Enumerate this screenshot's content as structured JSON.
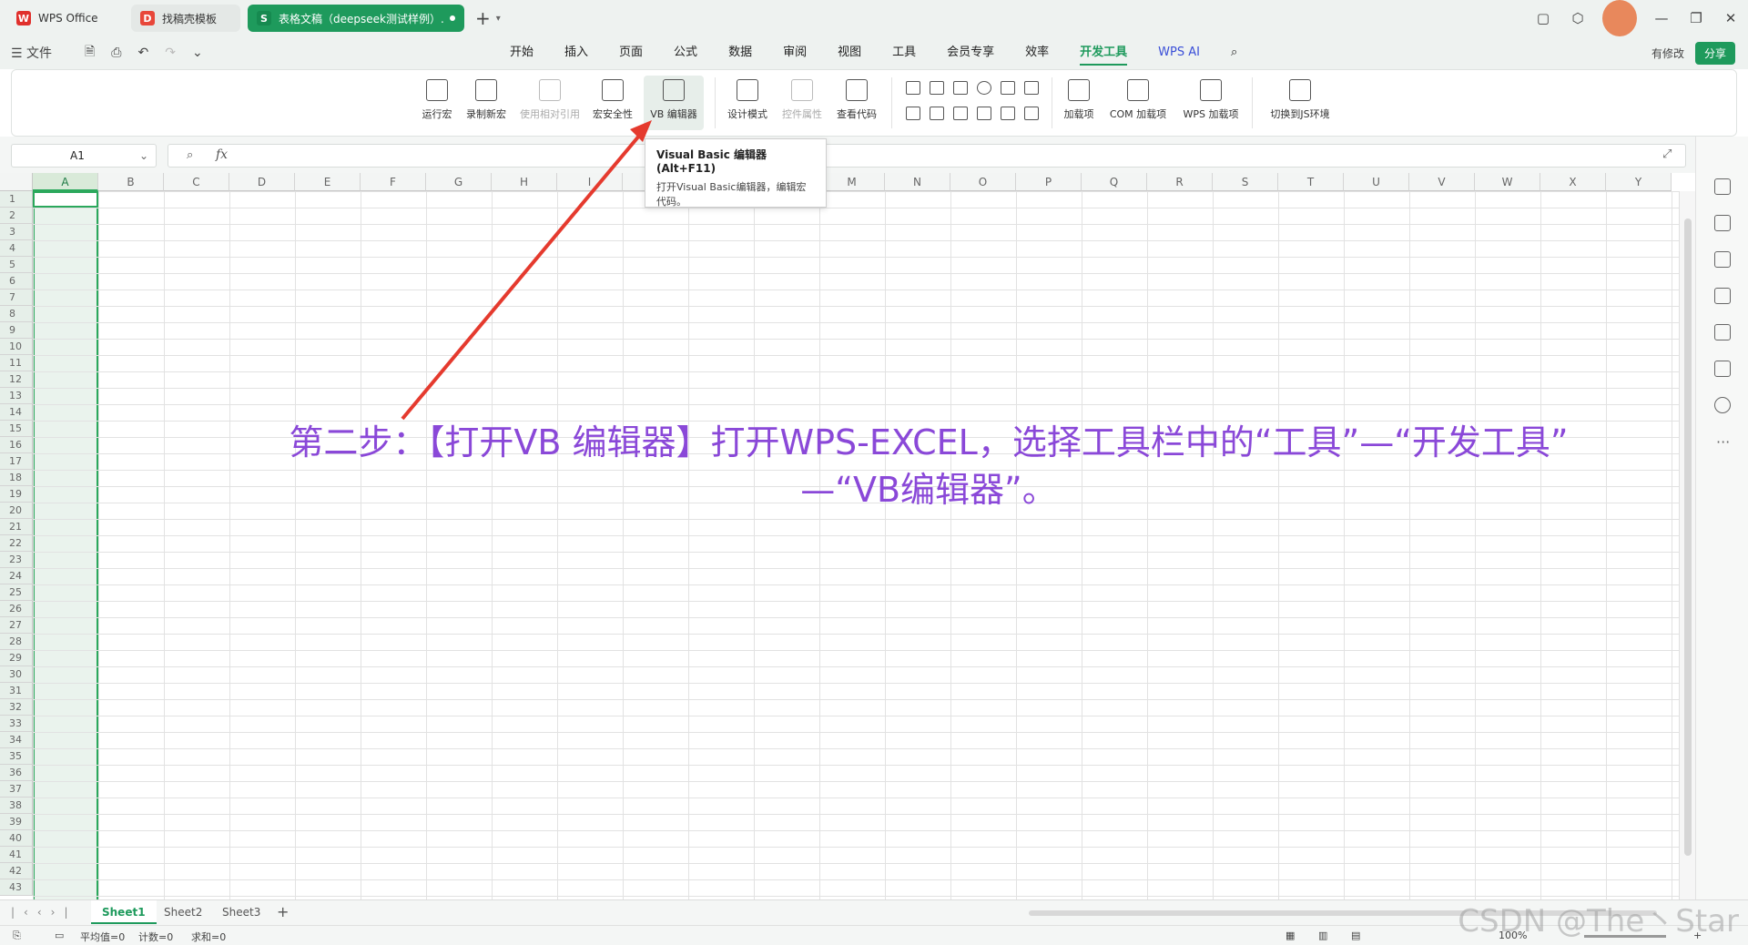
{
  "tabs": [
    {
      "label": "WPS Office",
      "icon": "wps-logo-icon"
    },
    {
      "label": "找稿壳模板",
      "icon": "template-icon"
    },
    {
      "label": "表格文稿（deepseek测试样例）.",
      "icon": "spreadsheet-icon"
    }
  ],
  "menubar": {
    "file": "文件",
    "items": [
      "开始",
      "插入",
      "页面",
      "公式",
      "数据",
      "审阅",
      "视图",
      "工具",
      "会员专享",
      "效率",
      "开发工具",
      "WPS AI"
    ],
    "active": "开发工具",
    "modified": "有修改",
    "share": "分享"
  },
  "ribbon": {
    "buttons": [
      {
        "label": "运行宏",
        "state": "normal"
      },
      {
        "label": "录制新宏",
        "state": "normal"
      },
      {
        "label": "使用相对引用",
        "state": "disabled"
      },
      {
        "label": "宏安全性",
        "state": "normal"
      },
      {
        "label": "VB 编辑器",
        "state": "highlighted"
      },
      {
        "label": "设计模式",
        "state": "normal"
      },
      {
        "label": "控件属性",
        "state": "disabled"
      },
      {
        "label": "查看代码",
        "state": "normal"
      },
      {
        "label": "加载项",
        "state": "normal"
      },
      {
        "label": "COM 加载项",
        "state": "normal"
      },
      {
        "label": "WPS 加载项",
        "state": "normal"
      },
      {
        "label": "切换到JS环境",
        "state": "normal"
      }
    ]
  },
  "tooltip": {
    "title": "Visual Basic 编辑器 (Alt+F11)",
    "desc": "打开Visual Basic编辑器，编辑宏代码。"
  },
  "formula_bar": {
    "name_box": "A1",
    "fx": "fx"
  },
  "grid": {
    "columns": [
      "A",
      "B",
      "C",
      "D",
      "E",
      "F",
      "G",
      "H",
      "I",
      "J",
      "K",
      "L",
      "M",
      "N",
      "O",
      "P",
      "Q",
      "R",
      "S",
      "T",
      "U",
      "V",
      "W",
      "X",
      "Y"
    ],
    "rows": [
      "1",
      "2",
      "3",
      "4",
      "5",
      "6",
      "7",
      "8",
      "9",
      "10",
      "11",
      "12",
      "13",
      "14",
      "15",
      "16",
      "17",
      "18",
      "19",
      "20",
      "21",
      "22",
      "23",
      "24",
      "25",
      "26",
      "27",
      "28",
      "29",
      "30",
      "31",
      "32",
      "33",
      "34",
      "35",
      "36",
      "37",
      "38",
      "39",
      "40",
      "41",
      "42",
      "43"
    ],
    "selected_column": "A",
    "active_cell": "A1"
  },
  "callout": {
    "line1": "第二步：【打开VB 编辑器】打开WPS-EXCEL，选择工具栏中的“工具”—“开发工具”",
    "line2": "—“VB编辑器”。",
    "color": "#8a48d8",
    "arrow_color": "#e53a2e"
  },
  "sheets": {
    "tabs": [
      "Sheet1",
      "Sheet2",
      "Sheet3"
    ],
    "active": "Sheet1",
    "add": "+"
  },
  "status": {
    "avg": "平均值=0",
    "count": "计数=0",
    "sum": "求和=0",
    "zoom": "100%"
  },
  "watermark": "CSDN @The丶Star",
  "accent": "#1e9a5c"
}
